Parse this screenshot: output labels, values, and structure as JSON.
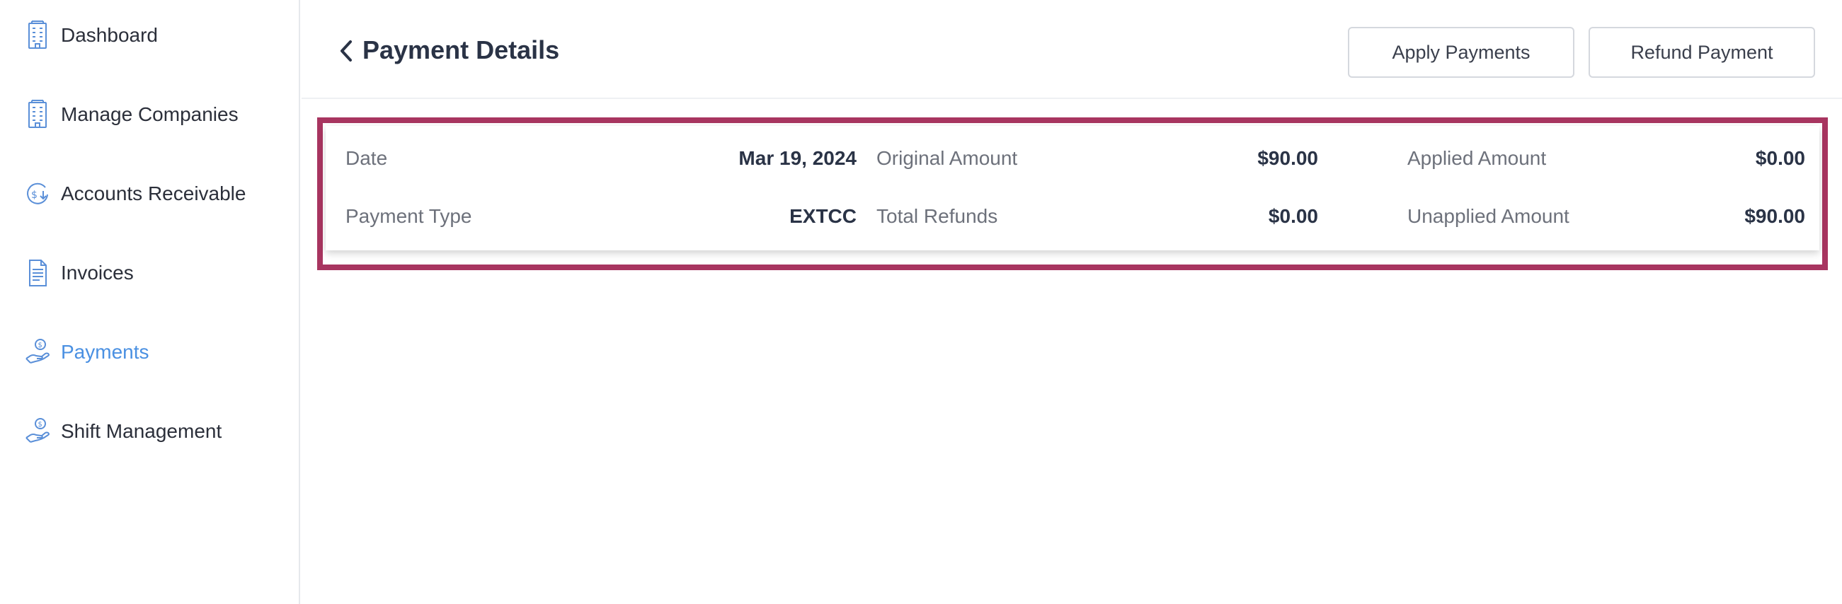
{
  "sidebar": {
    "items": [
      {
        "label": "Dashboard",
        "icon": "building-icon",
        "active": false
      },
      {
        "label": "Manage Companies",
        "icon": "building-icon",
        "active": false
      },
      {
        "label": "Accounts Receivable",
        "icon": "dollar-circle-icon",
        "active": false
      },
      {
        "label": "Invoices",
        "icon": "document-icon",
        "active": false
      },
      {
        "label": "Payments",
        "icon": "hand-coin-icon",
        "active": true
      },
      {
        "label": "Shift Management",
        "icon": "hand-coin-icon",
        "active": false
      }
    ]
  },
  "header": {
    "title": "Payment Details",
    "apply_payments_label": "Apply Payments",
    "refund_payment_label": "Refund Payment"
  },
  "details": {
    "date_label": "Date",
    "date_value": "Mar 19, 2024",
    "payment_type_label": "Payment Type",
    "payment_type_value": "EXTCC",
    "original_amount_label": "Original Amount",
    "original_amount_value": "$90.00",
    "total_refunds_label": "Total Refunds",
    "total_refunds_value": "$0.00",
    "applied_amount_label": "Applied Amount",
    "applied_amount_value": "$0.00",
    "unapplied_amount_label": "Unapplied Amount",
    "unapplied_amount_value": "$90.00"
  },
  "colors": {
    "accent": "#4a90e2",
    "highlight_border": "#a83560",
    "title": "#2a3346"
  }
}
